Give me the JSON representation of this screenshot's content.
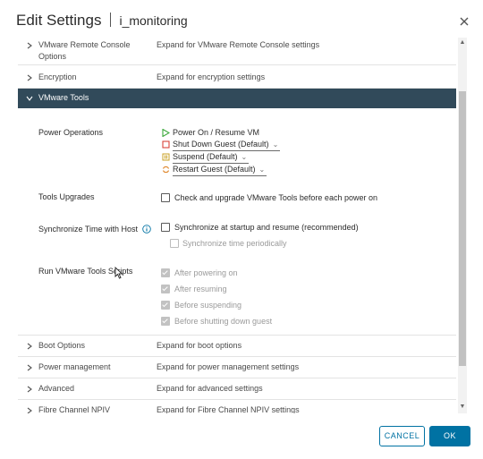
{
  "dialog": {
    "title": "Edit Settings",
    "vm_name": "i_monitoring"
  },
  "sections_top": [
    {
      "label": "VMware Remote Console",
      "label2": "Options",
      "desc": "Expand for VMware Remote Console settings"
    },
    {
      "label": "Encryption",
      "desc": "Expand for encryption settings"
    }
  ],
  "vmware_tools": {
    "label": "VMware Tools",
    "power_operations": {
      "label": "Power Operations",
      "power_on": "Power On / Resume VM",
      "shutdown": "Shut Down Guest (Default)",
      "suspend": "Suspend (Default)",
      "restart": "Restart Guest (Default)"
    },
    "tools_upgrades": {
      "label": "Tools Upgrades",
      "option": "Check and upgrade VMware Tools before each power on"
    },
    "sync_time": {
      "label": "Synchronize Time with Host",
      "option1": "Synchronize at startup and resume (recommended)",
      "option2": "Synchronize time periodically"
    },
    "run_scripts": {
      "label": "Run VMware Tools Scripts",
      "after_power_on": "After powering on",
      "after_resume": "After resuming",
      "before_suspend": "Before suspending",
      "before_shutdown": "Before shutting down guest"
    }
  },
  "sections_bottom": [
    {
      "label": "Boot Options",
      "desc": "Expand for boot options"
    },
    {
      "label": "Power management",
      "desc": "Expand for power management settings"
    },
    {
      "label": "Advanced",
      "desc": "Expand for advanced settings"
    },
    {
      "label": "Fibre Channel NPIV",
      "desc": "Expand for Fibre Channel NPIV settings"
    }
  ],
  "buttons": {
    "cancel": "CANCEL",
    "ok": "OK"
  },
  "colors": {
    "accent": "#0072a3",
    "expanded_header": "#314a5a",
    "power_on_icon": "#3aa83a",
    "shutdown_icon": "#d9443b",
    "suspend_icon": "#c9a227",
    "restart_icon": "#e0872b"
  },
  "icons": {
    "close": "close-icon",
    "chevron": "chevron-right-icon",
    "info": "info-icon"
  }
}
